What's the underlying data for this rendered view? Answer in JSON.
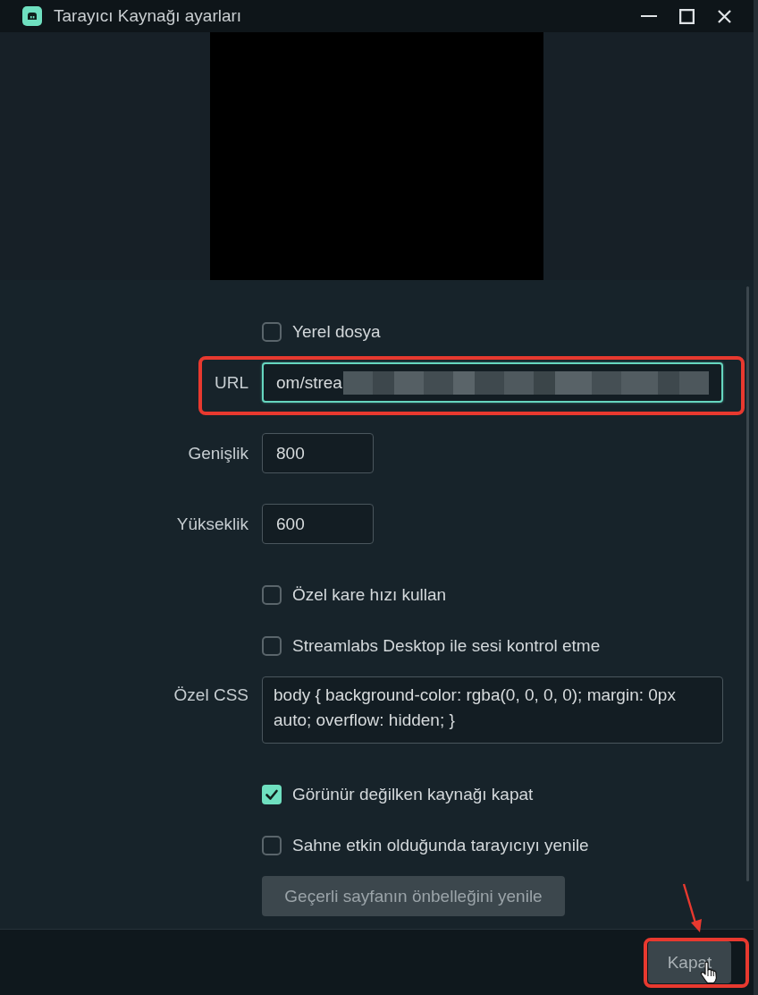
{
  "window": {
    "title": "Tarayıcı Kaynağı ayarları"
  },
  "form": {
    "fields": [
      {
        "kind": "checkbox",
        "label": "Yerel dosya",
        "checked": false
      },
      {
        "kind": "text",
        "label": "URL",
        "value": "om/strea",
        "focused": true,
        "highlighted": true,
        "redacted": true
      },
      {
        "kind": "number",
        "label": "Genişlik",
        "value": "800",
        "focused": false,
        "highlighted": false,
        "redacted": false
      },
      {
        "kind": "number",
        "label": "Yükseklik",
        "value": "600",
        "focused": false,
        "highlighted": false,
        "redacted": false
      },
      {
        "kind": "checkbox",
        "label": "Özel kare hızı kullan",
        "checked": false
      },
      {
        "kind": "checkbox",
        "label": "Streamlabs Desktop ile sesi kontrol etme",
        "checked": false
      },
      {
        "kind": "textarea",
        "label": "Özel CSS",
        "value": "body { background-color: rgba(0, 0, 0, 0); margin: 0px auto; overflow: hidden; }"
      },
      {
        "kind": "checkbox",
        "label": "Görünür değilken kaynağı kapat",
        "checked": true
      },
      {
        "kind": "checkbox",
        "label": "Sahne etkin olduğunda tarayıcıyı yenile",
        "checked": false
      },
      {
        "kind": "button",
        "label": "Geçerli sayfanın önbelleğini yenile"
      }
    ]
  },
  "footer": {
    "buttons": [
      {
        "label": "Kapat",
        "highlighted": true
      }
    ]
  }
}
